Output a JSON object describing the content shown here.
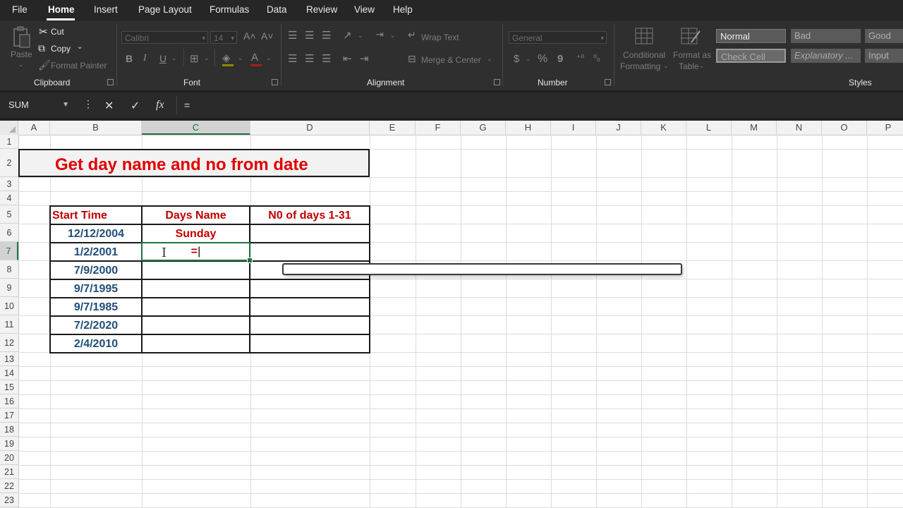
{
  "menu": {
    "items": [
      "File",
      "Home",
      "Insert",
      "Page Layout",
      "Formulas",
      "Data",
      "Review",
      "View",
      "Help"
    ],
    "active": "Home"
  },
  "ribbon": {
    "clipboard": {
      "paste": "Paste",
      "cut": "Cut",
      "copy": "Copy",
      "format_painter": "Format Painter",
      "label": "Clipboard"
    },
    "font": {
      "name": "Calibri",
      "size": "14",
      "bold": "B",
      "italic": "I",
      "underline": "U",
      "label": "Font"
    },
    "alignment": {
      "wrap_text": "Wrap Text",
      "merge_center": "Merge & Center",
      "label": "Alignment"
    },
    "number": {
      "format": "General",
      "currency": "$",
      "percent": "%",
      "comma": "9",
      "label": "Number"
    },
    "styles": {
      "conditional_formatting_1": "Conditional",
      "conditional_formatting_2": "Formatting",
      "format_as_table_1": "Format as",
      "format_as_table_2": "Table",
      "normal": "Normal",
      "bad": "Bad",
      "good": "Good",
      "check_cell": "Check Cell",
      "explanatory": "Explanatory ...",
      "input": "Input",
      "label": "Styles"
    }
  },
  "formula_bar": {
    "name_box": "SUM",
    "cancel": "✕",
    "enter": "✓",
    "fx": "fx",
    "content": "="
  },
  "grid": {
    "columns": [
      "A",
      "B",
      "C",
      "D",
      "E",
      "F",
      "G",
      "H",
      "I",
      "J",
      "K",
      "L",
      "M",
      "N",
      "O",
      "P"
    ],
    "rows": [
      "1",
      "2",
      "3",
      "4",
      "5",
      "6",
      "7",
      "8",
      "9",
      "10",
      "11",
      "12",
      "13",
      "14",
      "15",
      "16",
      "17",
      "18",
      "19",
      "20",
      "21",
      "22",
      "23"
    ],
    "selected_column": "C",
    "selected_row": "7"
  },
  "sheet": {
    "title": "Get day name and no from date",
    "headers": [
      "Start Time",
      "Days Name",
      "N0 of days 1-31"
    ],
    "dates": [
      "12/12/2004",
      "1/2/2001",
      "7/9/2000",
      "9/7/1995",
      "9/7/1985",
      "7/2/2020",
      "2/4/2010"
    ],
    "c6": "Sunday",
    "editing_cell": "=",
    "editing_address": "C7"
  },
  "colors": {
    "title_red": "#e00000",
    "header_red": "#c00000",
    "date_blue": "#1f4e79",
    "selection_green": "#217346"
  }
}
